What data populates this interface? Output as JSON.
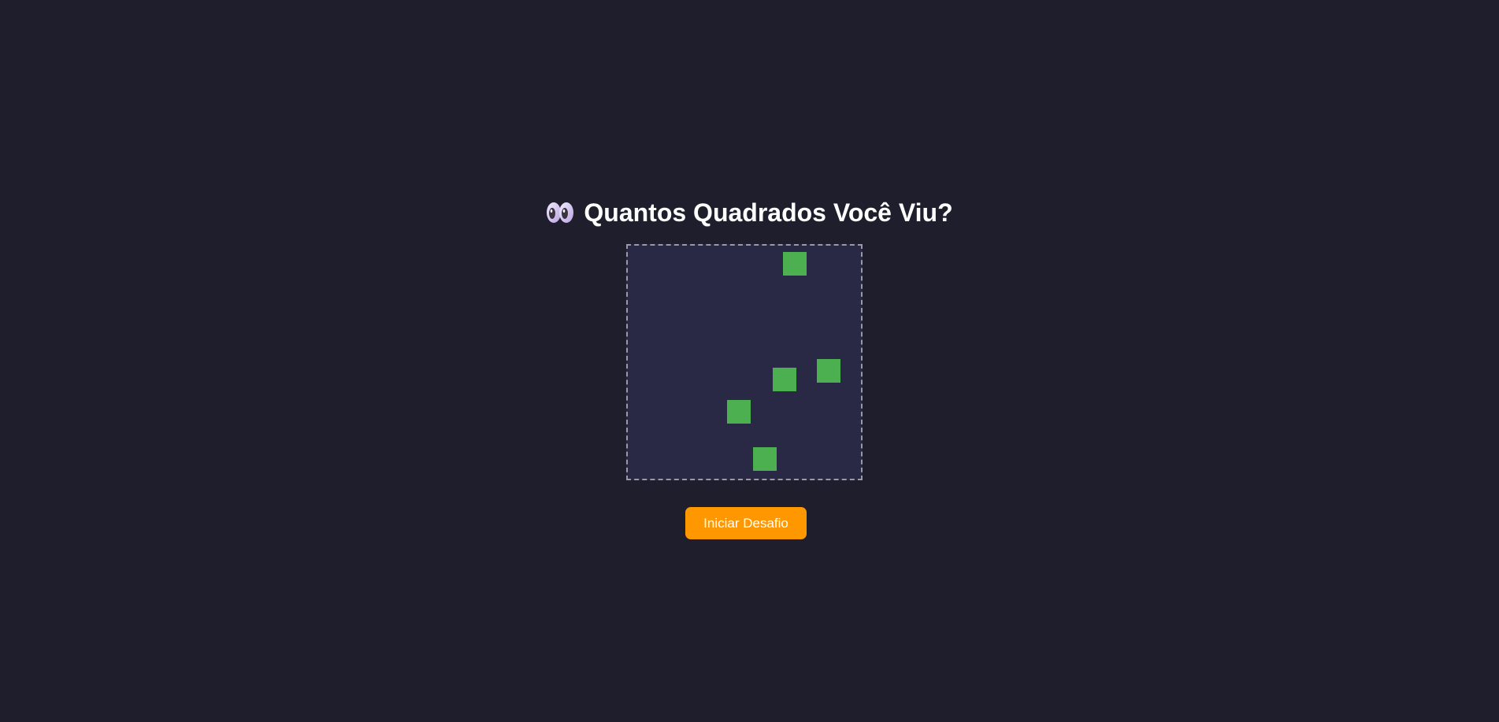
{
  "game": {
    "title": "Quantos Quadrados Você Viu?",
    "title_icon": "eyes-icon",
    "start_button_label": "Iniciar Desafio",
    "squares_visible": 5,
    "colors": {
      "background": "#1f1e2d",
      "board": "#292946",
      "square": "#4caf50",
      "button": "#ff9800"
    }
  }
}
